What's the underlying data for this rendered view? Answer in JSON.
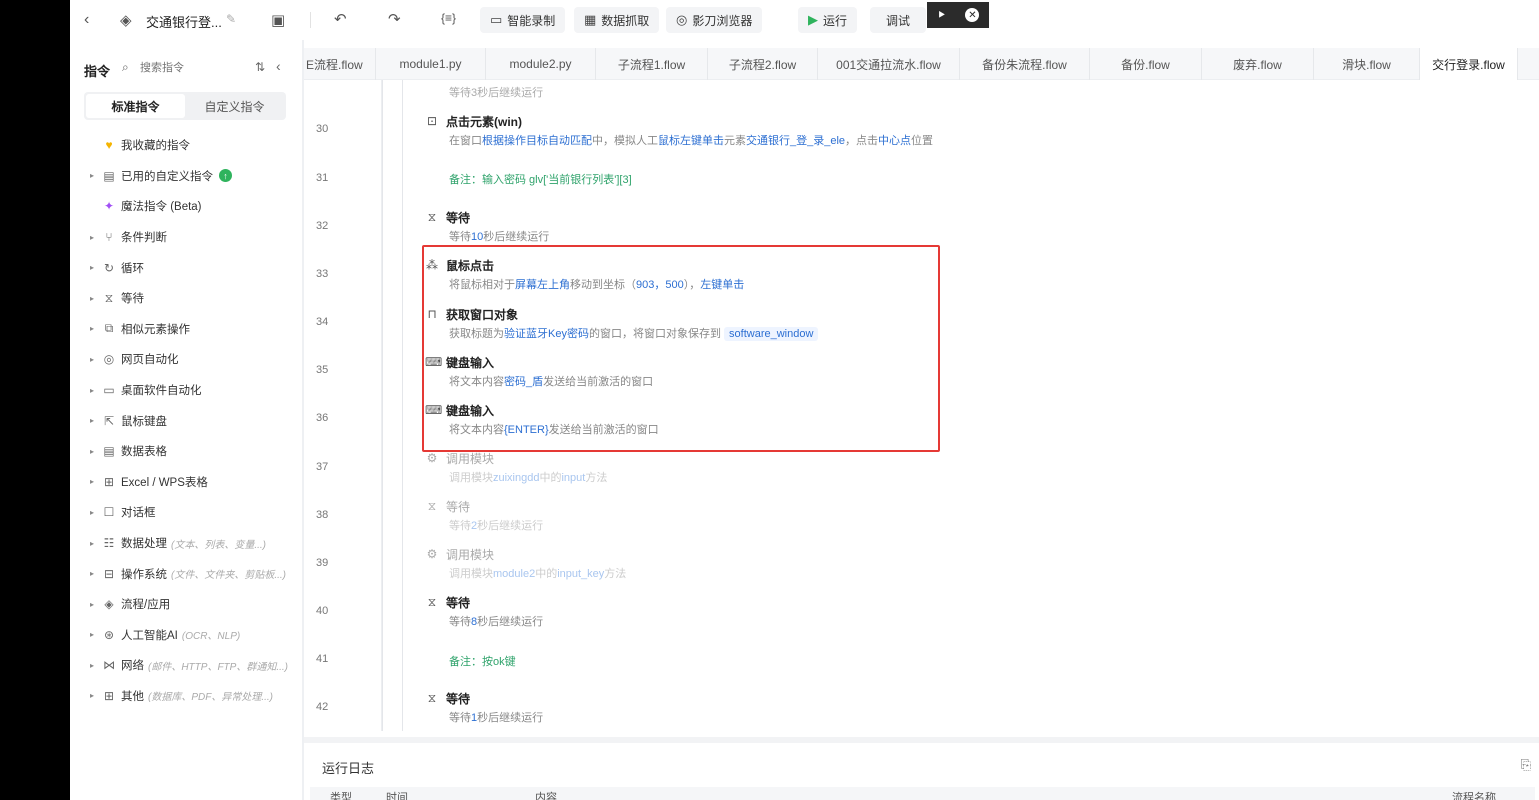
{
  "toolbar": {
    "title": "交通银行登...",
    "smart_record": "智能录制",
    "data_capture": "数据抓取",
    "browser": "影刀浏览器",
    "run": "运行",
    "debug": "调试"
  },
  "left_panel": {
    "title": "指令",
    "search_placeholder": "搜索指令",
    "tab_standard": "标准指令",
    "tab_custom": "自定义指令",
    "items": [
      {
        "label": "我收藏的指令",
        "hint": "",
        "icon": "heart-icon"
      },
      {
        "label": "已用的自定义指令",
        "hint": "",
        "icon": "box-icon"
      },
      {
        "label": "魔法指令 (Beta)",
        "hint": "",
        "icon": "sparkle-icon"
      },
      {
        "label": "条件判断",
        "hint": "",
        "icon": "branch-icon"
      },
      {
        "label": "循环",
        "hint": "",
        "icon": "loop-icon"
      },
      {
        "label": "等待",
        "hint": "",
        "icon": "hourglass-icon"
      },
      {
        "label": "相似元素操作",
        "hint": "",
        "icon": "copy-icon"
      },
      {
        "label": "网页自动化",
        "hint": "",
        "icon": "browser-icon"
      },
      {
        "label": "桌面软件自动化",
        "hint": "",
        "icon": "desktop-icon"
      },
      {
        "label": "鼠标键盘",
        "hint": "",
        "icon": "cursor-icon"
      },
      {
        "label": "数据表格",
        "hint": "",
        "icon": "table-icon"
      },
      {
        "label": "Excel / WPS表格",
        "hint": "",
        "icon": "excel-icon"
      },
      {
        "label": "对话框",
        "hint": "",
        "icon": "dialog-icon"
      },
      {
        "label": "数据处理",
        "hint": "(文本、列表、变量...)",
        "icon": "data-icon"
      },
      {
        "label": "操作系统",
        "hint": "(文件、文件夹、剪贴板...)",
        "icon": "os-icon"
      },
      {
        "label": "流程/应用",
        "hint": "",
        "icon": "layers-icon"
      },
      {
        "label": "人工智能AI",
        "hint": "(OCR、NLP)",
        "icon": "ai-icon"
      },
      {
        "label": "网络",
        "hint": "(邮件、HTTP、FTP、群通知...)",
        "icon": "network-icon"
      },
      {
        "label": "其他",
        "hint": "(数据库、PDF、异常处理...)",
        "icon": "grid-icon"
      }
    ]
  },
  "tabs": [
    {
      "label": "E流程.flow",
      "active": false
    },
    {
      "label": "module1.py",
      "active": false
    },
    {
      "label": "module2.py",
      "active": false
    },
    {
      "label": "子流程1.flow",
      "active": false
    },
    {
      "label": "子流程2.flow",
      "active": false
    },
    {
      "label": "001交通拉流水.flow",
      "active": false
    },
    {
      "label": "备份朱流程.flow",
      "active": false
    },
    {
      "label": "备份.flow",
      "active": false
    },
    {
      "label": "废弃.flow",
      "active": false
    },
    {
      "label": "滑块.flow",
      "active": false
    },
    {
      "label": "交行登录.flow",
      "active": true
    }
  ],
  "editor": {
    "line_numbers": [
      "30",
      "31",
      "32",
      "33",
      "34",
      "35",
      "36",
      "37",
      "38",
      "39",
      "40",
      "41",
      "42"
    ],
    "top_fragment": "等待3秒后继续运行",
    "steps": {
      "click_element": {
        "title": "点击元素(win)",
        "d1": "在窗口",
        "d2": "根据操作目标自动匹配",
        "d3": "中，模拟人工",
        "d4": "鼠标左键单击",
        "d5": "元素",
        "d6": "交通银行_登_录_ele",
        "d7": "，点击",
        "d8": "中心点",
        "d9": "位置"
      },
      "comment_31": "备注：输入密码 glv['当前银行列表'][3]",
      "wait_32": {
        "title": "等待",
        "d1": "等待",
        "d2": "10",
        "d3": "秒后继续运行"
      },
      "mouse_click": {
        "title": "鼠标点击",
        "d1": "将鼠标相对于",
        "d2": "屏幕左上角",
        "d3": "移动到坐标（",
        "d4": "903，500",
        "d5": "），",
        "d6": "左键单击"
      },
      "get_window": {
        "title": "获取窗口对象",
        "d1": "获取标题为",
        "d2": "验证蓝牙Key密码",
        "d3": "的窗口，将窗口对象保存到",
        "d4": "software_window"
      },
      "keyboard_1": {
        "title": "键盘输入",
        "d1": "将文本内容",
        "d2": "密码_盾",
        "d3": "发送给当前激活的窗口"
      },
      "keyboard_2": {
        "title": "键盘输入",
        "d1": "将文本内容",
        "d2": "{ENTER}",
        "d3": "发送给当前激活的窗口"
      },
      "call_module_37": {
        "title": "调用模块",
        "d1": "调用模块",
        "d2": "zuixingdd",
        "d3": "中的",
        "d4": "input",
        "d5": "方法"
      },
      "wait_38": {
        "title": "等待",
        "d1": "等待",
        "d2": "2",
        "d3": "秒后继续运行"
      },
      "call_module_39": {
        "title": "调用模块",
        "d1": "调用模块",
        "d2": "module2",
        "d3": "中的",
        "d4": "input_key",
        "d5": "方法"
      },
      "wait_40": {
        "title": "等待",
        "d1": "等待",
        "d2": "8",
        "d3": "秒后继续运行"
      },
      "comment_41": "备注：按ok键",
      "wait_42": {
        "title": "等待",
        "d1": "等待",
        "d2": "1",
        "d3": "秒后继续运行"
      }
    }
  },
  "run_log": {
    "title": "运行日志",
    "columns": [
      "类型",
      "时间",
      "内容",
      "流程名称"
    ]
  },
  "colors": {
    "accent": "#2d6fd2",
    "comment": "#2fa36b",
    "highlight_box": "#e53935",
    "badge": "#2fb35d"
  }
}
